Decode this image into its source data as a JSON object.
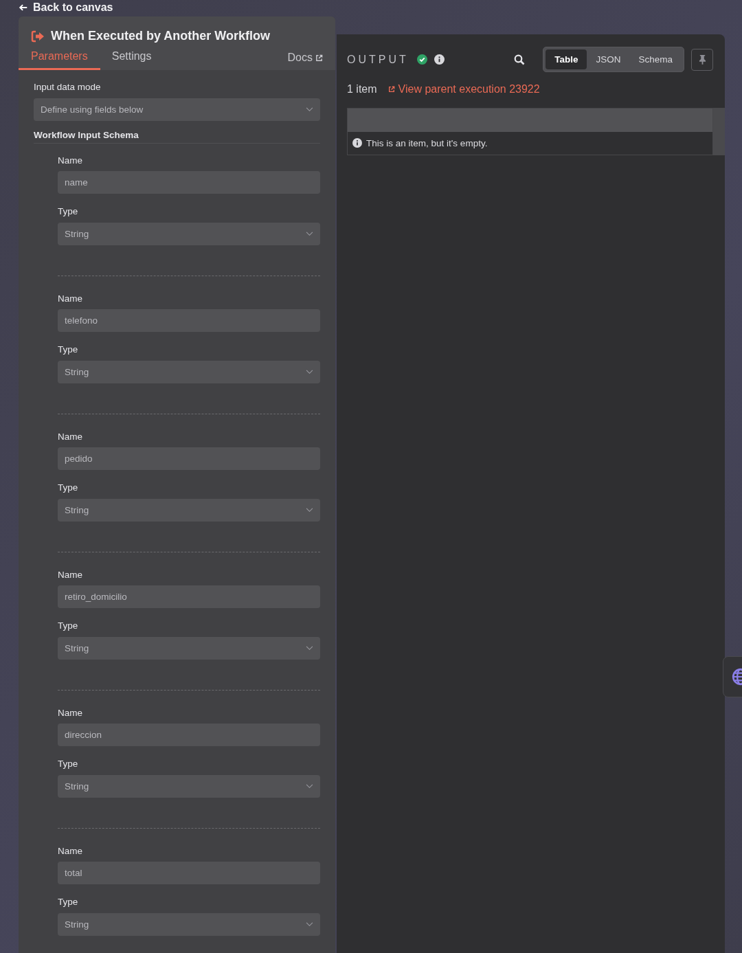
{
  "back_link": "Back to canvas",
  "node_panel": {
    "title": "When Executed by Another Workflow",
    "tabs": [
      {
        "label": "Parameters",
        "selected": true
      },
      {
        "label": "Settings",
        "selected": false
      }
    ],
    "docs_link": "Docs",
    "input_data_mode": {
      "label": "Input data mode",
      "value": "Define using fields below"
    },
    "schema_heading": "Workflow Input Schema",
    "fields": [
      {
        "name_label": "Name",
        "name": "name",
        "type_label": "Type",
        "type": "String"
      },
      {
        "name_label": "Name",
        "name": "telefono",
        "type_label": "Type",
        "type": "String"
      },
      {
        "name_label": "Name",
        "name": "pedido",
        "type_label": "Type",
        "type": "String"
      },
      {
        "name_label": "Name",
        "name": "retiro_domicilio",
        "type_label": "Type",
        "type": "String"
      },
      {
        "name_label": "Name",
        "name": "direccion",
        "type_label": "Type",
        "type": "String"
      },
      {
        "name_label": "Name",
        "name": "total",
        "type_label": "Type",
        "type": "String"
      }
    ]
  },
  "output_panel": {
    "title": "OUTPUT",
    "views": [
      {
        "label": "Table",
        "selected": true
      },
      {
        "label": "JSON",
        "selected": false
      },
      {
        "label": "Schema",
        "selected": false
      }
    ],
    "item_count": "1 item",
    "parent_link": "View parent execution 23922",
    "empty_message": "This is an item, but it's empty."
  }
}
